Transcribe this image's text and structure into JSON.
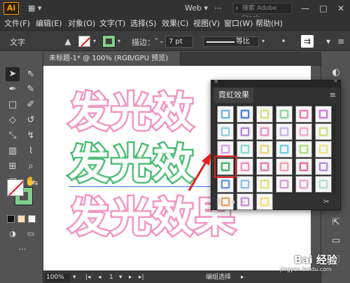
{
  "app": {
    "logo": "Ai",
    "workspace": "Web",
    "search_placeholder": "搜索 Adobe Stock",
    "window_controls": [
      "—",
      "□",
      "✕"
    ]
  },
  "menu": [
    "文件(F)",
    "编辑(E)",
    "对象(O)",
    "文字(T)",
    "选择(S)",
    "效果(C)",
    "视图(V)",
    "窗口(W)",
    "帮助(H)"
  ],
  "control_bar": {
    "mode_label": "文字",
    "stroke_label": "描边：",
    "stroke_value": "7 pt",
    "stroke_profile": "等比",
    "fill_icon": "none-swatch",
    "stroke_color": "#7fcf8c"
  },
  "document": {
    "tab_title": "未标题-1* @ 100% (RGB/GPU 预览)",
    "lines": [
      {
        "text": "发光效",
        "style": "pink"
      },
      {
        "text": "发光效",
        "style": "green"
      },
      {
        "text": "发光效果",
        "style": "pink"
      }
    ]
  },
  "status": {
    "zoom": "100%",
    "page": "1",
    "tool_status": "编组选择"
  },
  "panel": {
    "title": "霓虹效果",
    "selected_index": 18,
    "swatches": [
      {
        "color": "#6fb5e6"
      },
      {
        "color": "#4f7fd8"
      },
      {
        "color": "#d6e07a"
      },
      {
        "color": "#8fd89c"
      },
      {
        "color": "#f07bb0"
      },
      {
        "color": "#c97be0"
      },
      {
        "color": "#8fd0e6"
      },
      {
        "color": "#b383d8"
      },
      {
        "color": "#f08fbf"
      },
      {
        "color": "#c9b3e8"
      },
      {
        "color": "#f4a7c7"
      },
      {
        "color": "#c8e07a"
      },
      {
        "color": "#d9a0e6"
      },
      {
        "color": "#8fd8d2"
      },
      {
        "color": "#e8d47a"
      },
      {
        "color": "#6fd0e0"
      },
      {
        "color": "#b0e07a"
      },
      {
        "color": "#f2e08a"
      },
      {
        "color": "#3fb56a"
      },
      {
        "color": "#f08fbf"
      },
      {
        "color": "#e57ab0"
      },
      {
        "color": "#f4a0b0"
      },
      {
        "color": "#e06a9a"
      },
      {
        "color": "#b08fd8"
      },
      {
        "color": "#5f96e0"
      },
      {
        "color": "#8fc0e6"
      },
      {
        "color": "#e0e07a"
      },
      {
        "color": "#d9a0d0"
      },
      {
        "color": "#e8a0d0"
      },
      {
        "color": "#b0e0d0"
      },
      {
        "color": "#e6a060"
      },
      {
        "color": "#c78fd8"
      },
      {
        "color": "#f2e07a"
      }
    ]
  },
  "watermark": {
    "main": "Bai 经验",
    "sub": "jingyan.baidu.com"
  }
}
